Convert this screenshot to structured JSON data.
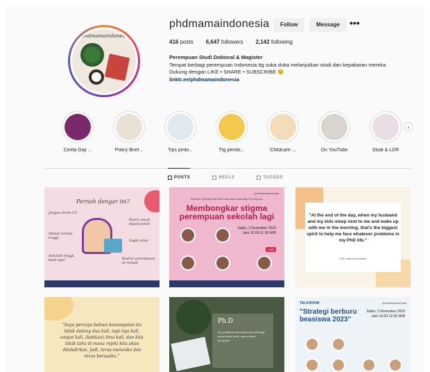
{
  "profile": {
    "username": "phdmamaindonesia",
    "follow_label": "Follow",
    "message_label": "Message",
    "more_label": "•••",
    "posts_count": "416",
    "posts_label": "posts",
    "followers_count": "6,647",
    "followers_label": "followers",
    "following_count": "2,142",
    "following_label": "following",
    "avatar_text": "phdmamaindonesia",
    "bio_name": "Perempuan Studi Doktoral & Magister",
    "bio_line1": "Tempat berbagi perempuan Indonesia ",
    "bio_line2": "Dukung dengan LIKE • SHARE • SUBSCRIBE 😊",
    "bio_link": "linktr.ee/phdmamaindonesia",
    "bio_line1_full": "Tempat berbagi perempuan Indonesia ttg suka duka melanjutkan studi dan kepakaran mereka"
  },
  "highlights": [
    {
      "label": "Cerita Gaji ...",
      "color": "#7a2a6a"
    },
    {
      "label": "Policy Brief...",
      "color": "#e9e1d6"
    },
    {
      "label": "Tips pmbi...",
      "color": "#dfe9ef"
    },
    {
      "label": "Ttg pembi...",
      "color": "#f2c94c"
    },
    {
      "label": "Childcare ...",
      "color": "#f3ddb8"
    },
    {
      "label": "On YouTube",
      "color": "#d9d4ce"
    },
    {
      "label": "Studi & LDR",
      "color": "#eadde6"
    }
  ],
  "tabs": {
    "posts": "POSTS",
    "reels": "REELS",
    "tagged": "TAGGED"
  },
  "posts": {
    "p1": {
      "title": "Pernah dengar ini?",
      "scribble_left1": "Jangan kirim CV",
      "scribble_left2": "Mimpi terlalu tinggi",
      "scribble_left3": "Sekolah tinggi, buat apa?",
      "scribble_right1": "Nanti susah dapat jodoh",
      "scribble_right2": "Ingat umur",
      "scribble_right3": "Kodrat perempuan di rumah"
    },
    "p2": {
      "top": "Webinar Spesial Hari Anti Kekerasan terhadap Perempuan",
      "brand": "phdmamaindonesia",
      "title_line1": "Membongkar stigma",
      "title_line2": "perempuan sekolah lagi",
      "date": "Sabtu, 2 Desember 2023",
      "time": "Jam 10.00-11.30 WIB",
      "live": "LIVE"
    },
    "p3": {
      "quote": "\"At the end of the day, when my husband and my kids sleep next to me and wake up with me in the morning, that's the biggest spirit to help me face whatever problems in my PhD life.\"",
      "by": "PhD mama Indonesia"
    },
    "p4": {
      "quote": "\"Saya percaya bahwa kesempatan itu tidak datang dua kali, tapi tiga kali, empat kali, (bahkan) lima kali, dan kita tidak tahu di mana rejeki kita akan ditakdirkan. Jadi, terus mencoba dan terus berusaha.\""
    },
    "p5": {
      "title": "Ph.D",
      "text": "Ini perjalanan studi saya dan keluarga, penuh suka duka, namun kami bersyukur."
    },
    "p6": {
      "head": "TALKSHOW",
      "brand": "phdmamaindonesia",
      "title": "\"Strategi berburu beasiswa 2023\"",
      "date": "Sabtu, 3 November 2023",
      "time": "Jam 10.00-12.00 WIB"
    }
  }
}
